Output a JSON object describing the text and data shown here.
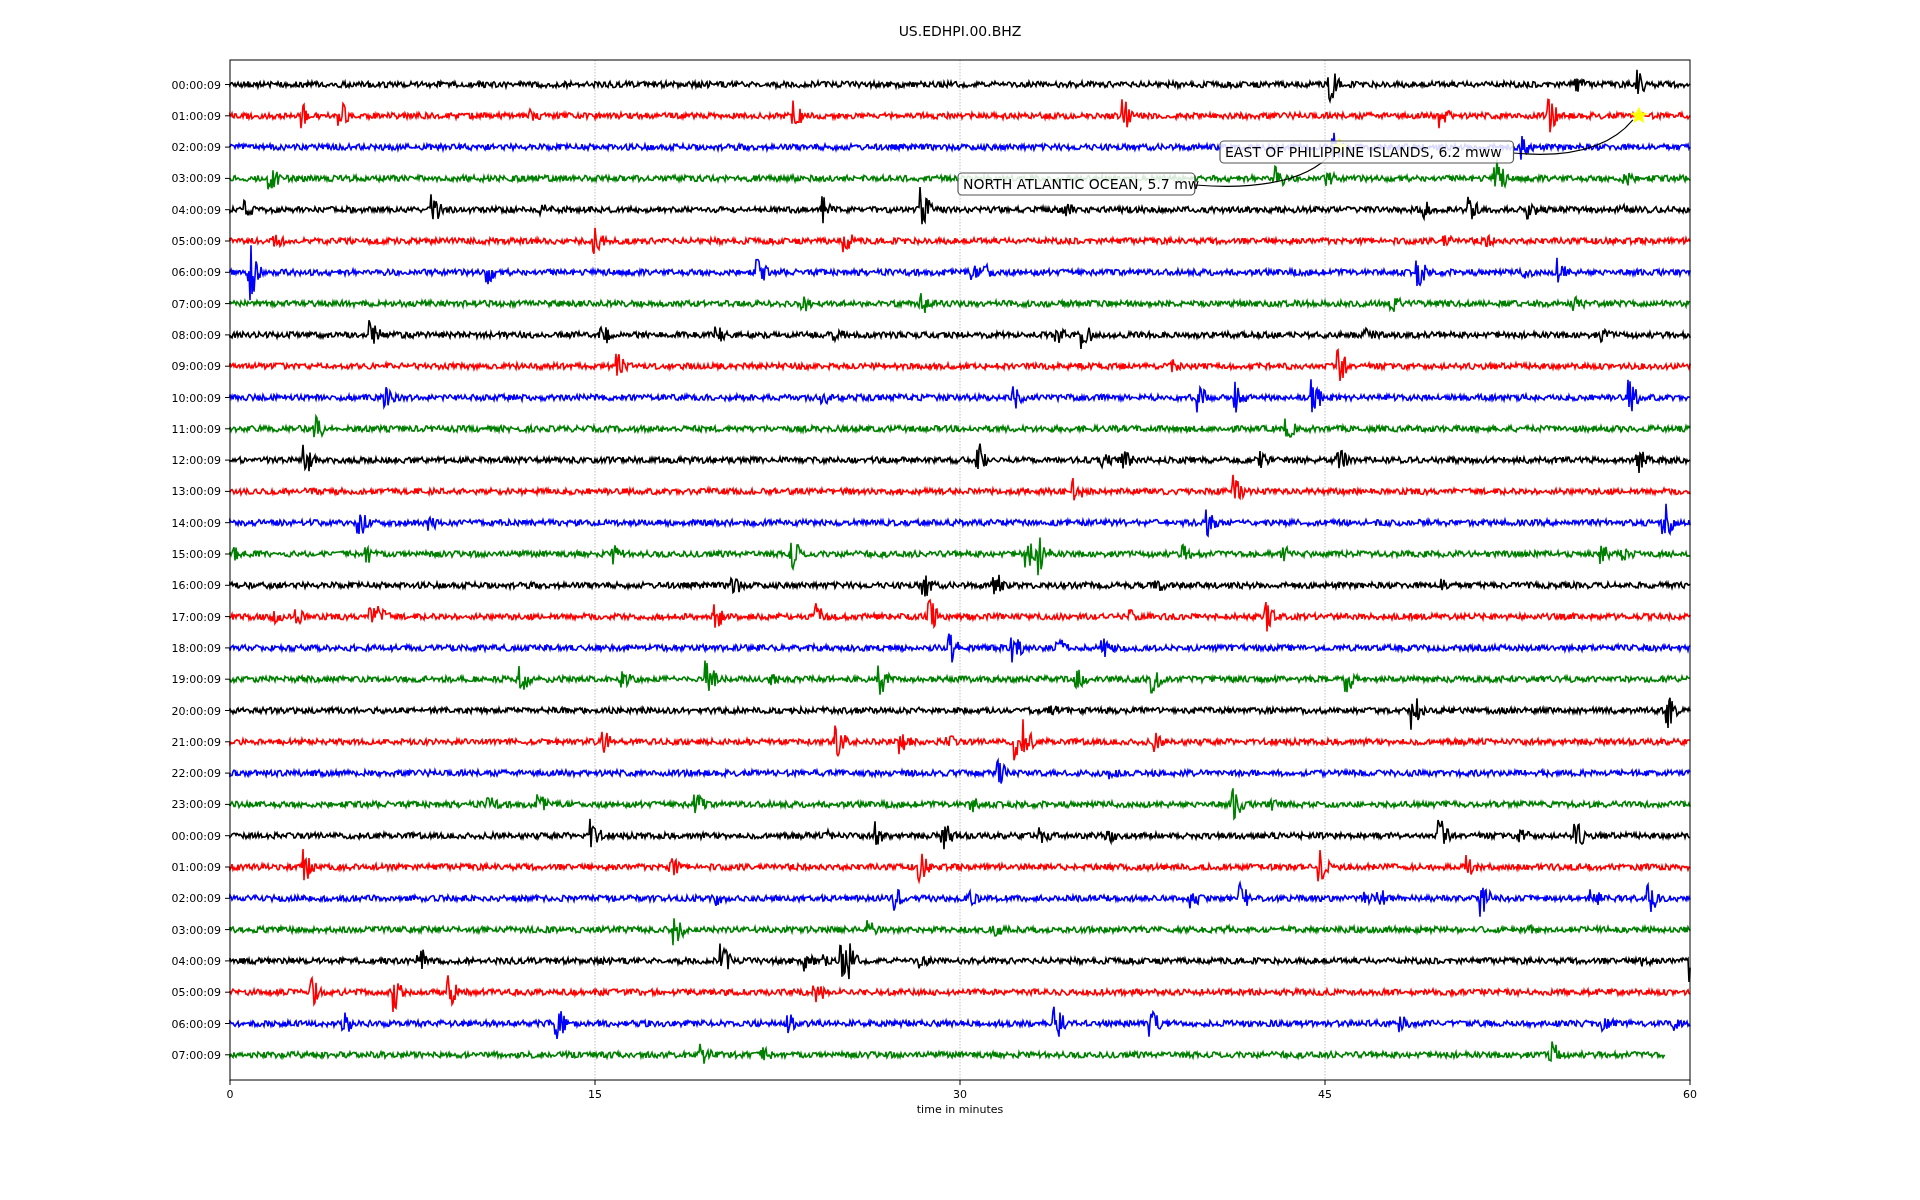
{
  "title": "US.EDHPI.00.BHZ",
  "x_axis": {
    "label": "time in minutes",
    "ticks": [
      "0",
      "15",
      "30",
      "45",
      "60"
    ]
  },
  "rows": [
    {
      "label": "00:00:09",
      "color": "#000000"
    },
    {
      "label": "01:00:09",
      "color": "#ff0000"
    },
    {
      "label": "02:00:09",
      "color": "#0000ff"
    },
    {
      "label": "03:00:09",
      "color": "#008000"
    },
    {
      "label": "04:00:09",
      "color": "#000000"
    },
    {
      "label": "05:00:09",
      "color": "#ff0000"
    },
    {
      "label": "06:00:09",
      "color": "#0000ff"
    },
    {
      "label": "07:00:09",
      "color": "#008000"
    },
    {
      "label": "08:00:09",
      "color": "#000000"
    },
    {
      "label": "09:00:09",
      "color": "#ff0000"
    },
    {
      "label": "10:00:09",
      "color": "#0000ff"
    },
    {
      "label": "11:00:09",
      "color": "#008000"
    },
    {
      "label": "12:00:09",
      "color": "#000000"
    },
    {
      "label": "13:00:09",
      "color": "#ff0000"
    },
    {
      "label": "14:00:09",
      "color": "#0000ff"
    },
    {
      "label": "15:00:09",
      "color": "#008000"
    },
    {
      "label": "16:00:09",
      "color": "#000000"
    },
    {
      "label": "17:00:09",
      "color": "#ff0000"
    },
    {
      "label": "18:00:09",
      "color": "#0000ff"
    },
    {
      "label": "19:00:09",
      "color": "#008000"
    },
    {
      "label": "20:00:09",
      "color": "#000000"
    },
    {
      "label": "21:00:09",
      "color": "#ff0000"
    },
    {
      "label": "22:00:09",
      "color": "#0000ff"
    },
    {
      "label": "23:00:09",
      "color": "#008000"
    },
    {
      "label": "00:00:09",
      "color": "#000000"
    },
    {
      "label": "01:00:09",
      "color": "#ff0000"
    },
    {
      "label": "02:00:09",
      "color": "#0000ff"
    },
    {
      "label": "03:00:09",
      "color": "#008000"
    },
    {
      "label": "04:00:09",
      "color": "#000000"
    },
    {
      "label": "05:00:09",
      "color": "#ff0000"
    },
    {
      "label": "06:00:09",
      "color": "#0000ff"
    },
    {
      "label": "07:00:09",
      "color": "#008000"
    }
  ],
  "events": [
    {
      "text": "EAST OF PHILIPPINE ISLANDS, 6.2 mww"
    },
    {
      "text": "NORTH ATLANTIC OCEAN, 5.7 mw"
    }
  ]
}
